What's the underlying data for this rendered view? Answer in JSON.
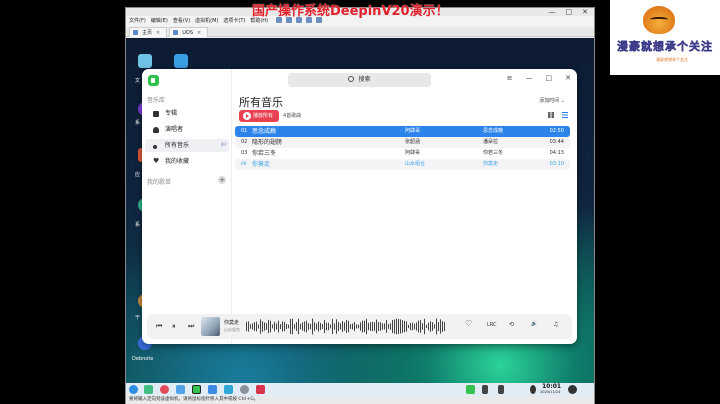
{
  "overlay_title": "国产操作系统DeepinV20演示！",
  "vm": {
    "window_controls": [
      "—",
      "□",
      "✕"
    ],
    "menu": [
      "文件(F)",
      "编辑(E)",
      "查看(V)",
      "虚拟机(M)",
      "选项卡(T)",
      "帮助(H)"
    ],
    "tabs": [
      {
        "label": "主页"
      },
      {
        "label": "UOS"
      }
    ],
    "status_text": "要将输入定向到该虚拟机，请将鼠标指针移入其中或按 Ctrl+G。"
  },
  "desktop": {
    "icon_labels": [
      "文",
      "系",
      "应",
      "系",
      "干",
      "Debnote"
    ]
  },
  "app": {
    "search_placeholder": "搜索",
    "window_controls": [
      "≡",
      "—",
      "□",
      "✕"
    ],
    "sidebar": {
      "library_title": "音乐库",
      "items": [
        {
          "label": "专辑",
          "icon": "album-icon"
        },
        {
          "label": "演唱者",
          "icon": "person-icon"
        },
        {
          "label": "所有音乐",
          "icon": "music-note-icon",
          "trail": "ılıl"
        },
        {
          "label": "我的收藏",
          "icon": "heart-icon"
        }
      ],
      "playlist_title": "我的歌单",
      "add": "+"
    },
    "page_title": "所有音乐",
    "play_all": "播放所有",
    "song_count": "4首歌曲",
    "sort": "添加时间 ⌄",
    "songs": [
      {
        "no": "01",
        "title": "思念成瘾",
        "artist": "阿肆哥",
        "album": "思念成瘾",
        "duration": "02:50",
        "state": "selected"
      },
      {
        "no": "02",
        "title": "隐形的翅膀",
        "artist": "张韶涵",
        "album": "潘朵拉",
        "duration": "03:44",
        "state": "alt"
      },
      {
        "no": "03",
        "title": "你若三冬",
        "artist": "阿肆哥",
        "album": "你若三冬",
        "duration": "04:13",
        "state": ""
      },
      {
        "no": "ılıl",
        "title": "你莫走",
        "artist": "山水组合",
        "album": "你莫走",
        "duration": "03:10",
        "state": "playing alt"
      }
    ],
    "player": {
      "prev": "⏮",
      "pause": "⏸",
      "next": "⏭",
      "now_title": "你莫走",
      "now_artist": "山水组合",
      "favorite": "♡",
      "lyrics": "LRC",
      "repeat": "⟲",
      "volume": "🔊",
      "playlist": "♫"
    }
  },
  "dock": {
    "time": "10:01",
    "date": "2020/11/24"
  },
  "brand": {
    "text": "漫豪就想承个关注",
    "subtitle": "漫豪就想承个关注"
  }
}
